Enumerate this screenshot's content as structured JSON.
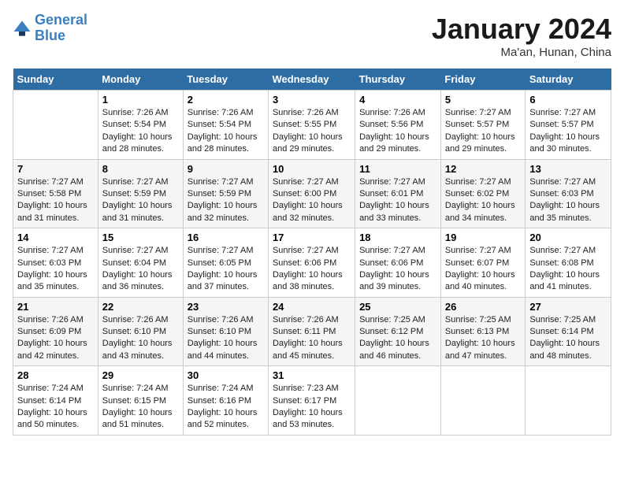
{
  "header": {
    "logo_general": "General",
    "logo_blue": "Blue",
    "month_title": "January 2024",
    "subtitle": "Ma'an, Hunan, China"
  },
  "weekdays": [
    "Sunday",
    "Monday",
    "Tuesday",
    "Wednesday",
    "Thursday",
    "Friday",
    "Saturday"
  ],
  "weeks": [
    [
      {
        "day": "",
        "info": ""
      },
      {
        "day": "1",
        "info": "Sunrise: 7:26 AM\nSunset: 5:54 PM\nDaylight: 10 hours and 28 minutes."
      },
      {
        "day": "2",
        "info": "Sunrise: 7:26 AM\nSunset: 5:54 PM\nDaylight: 10 hours and 28 minutes."
      },
      {
        "day": "3",
        "info": "Sunrise: 7:26 AM\nSunset: 5:55 PM\nDaylight: 10 hours and 29 minutes."
      },
      {
        "day": "4",
        "info": "Sunrise: 7:26 AM\nSunset: 5:56 PM\nDaylight: 10 hours and 29 minutes."
      },
      {
        "day": "5",
        "info": "Sunrise: 7:27 AM\nSunset: 5:57 PM\nDaylight: 10 hours and 29 minutes."
      },
      {
        "day": "6",
        "info": "Sunrise: 7:27 AM\nSunset: 5:57 PM\nDaylight: 10 hours and 30 minutes."
      }
    ],
    [
      {
        "day": "7",
        "info": "Sunrise: 7:27 AM\nSunset: 5:58 PM\nDaylight: 10 hours and 31 minutes."
      },
      {
        "day": "8",
        "info": "Sunrise: 7:27 AM\nSunset: 5:59 PM\nDaylight: 10 hours and 31 minutes."
      },
      {
        "day": "9",
        "info": "Sunrise: 7:27 AM\nSunset: 5:59 PM\nDaylight: 10 hours and 32 minutes."
      },
      {
        "day": "10",
        "info": "Sunrise: 7:27 AM\nSunset: 6:00 PM\nDaylight: 10 hours and 32 minutes."
      },
      {
        "day": "11",
        "info": "Sunrise: 7:27 AM\nSunset: 6:01 PM\nDaylight: 10 hours and 33 minutes."
      },
      {
        "day": "12",
        "info": "Sunrise: 7:27 AM\nSunset: 6:02 PM\nDaylight: 10 hours and 34 minutes."
      },
      {
        "day": "13",
        "info": "Sunrise: 7:27 AM\nSunset: 6:03 PM\nDaylight: 10 hours and 35 minutes."
      }
    ],
    [
      {
        "day": "14",
        "info": "Sunrise: 7:27 AM\nSunset: 6:03 PM\nDaylight: 10 hours and 35 minutes."
      },
      {
        "day": "15",
        "info": "Sunrise: 7:27 AM\nSunset: 6:04 PM\nDaylight: 10 hours and 36 minutes."
      },
      {
        "day": "16",
        "info": "Sunrise: 7:27 AM\nSunset: 6:05 PM\nDaylight: 10 hours and 37 minutes."
      },
      {
        "day": "17",
        "info": "Sunrise: 7:27 AM\nSunset: 6:06 PM\nDaylight: 10 hours and 38 minutes."
      },
      {
        "day": "18",
        "info": "Sunrise: 7:27 AM\nSunset: 6:06 PM\nDaylight: 10 hours and 39 minutes."
      },
      {
        "day": "19",
        "info": "Sunrise: 7:27 AM\nSunset: 6:07 PM\nDaylight: 10 hours and 40 minutes."
      },
      {
        "day": "20",
        "info": "Sunrise: 7:27 AM\nSunset: 6:08 PM\nDaylight: 10 hours and 41 minutes."
      }
    ],
    [
      {
        "day": "21",
        "info": "Sunrise: 7:26 AM\nSunset: 6:09 PM\nDaylight: 10 hours and 42 minutes."
      },
      {
        "day": "22",
        "info": "Sunrise: 7:26 AM\nSunset: 6:10 PM\nDaylight: 10 hours and 43 minutes."
      },
      {
        "day": "23",
        "info": "Sunrise: 7:26 AM\nSunset: 6:10 PM\nDaylight: 10 hours and 44 minutes."
      },
      {
        "day": "24",
        "info": "Sunrise: 7:26 AM\nSunset: 6:11 PM\nDaylight: 10 hours and 45 minutes."
      },
      {
        "day": "25",
        "info": "Sunrise: 7:25 AM\nSunset: 6:12 PM\nDaylight: 10 hours and 46 minutes."
      },
      {
        "day": "26",
        "info": "Sunrise: 7:25 AM\nSunset: 6:13 PM\nDaylight: 10 hours and 47 minutes."
      },
      {
        "day": "27",
        "info": "Sunrise: 7:25 AM\nSunset: 6:14 PM\nDaylight: 10 hours and 48 minutes."
      }
    ],
    [
      {
        "day": "28",
        "info": "Sunrise: 7:24 AM\nSunset: 6:14 PM\nDaylight: 10 hours and 50 minutes."
      },
      {
        "day": "29",
        "info": "Sunrise: 7:24 AM\nSunset: 6:15 PM\nDaylight: 10 hours and 51 minutes."
      },
      {
        "day": "30",
        "info": "Sunrise: 7:24 AM\nSunset: 6:16 PM\nDaylight: 10 hours and 52 minutes."
      },
      {
        "day": "31",
        "info": "Sunrise: 7:23 AM\nSunset: 6:17 PM\nDaylight: 10 hours and 53 minutes."
      },
      {
        "day": "",
        "info": ""
      },
      {
        "day": "",
        "info": ""
      },
      {
        "day": "",
        "info": ""
      }
    ]
  ]
}
